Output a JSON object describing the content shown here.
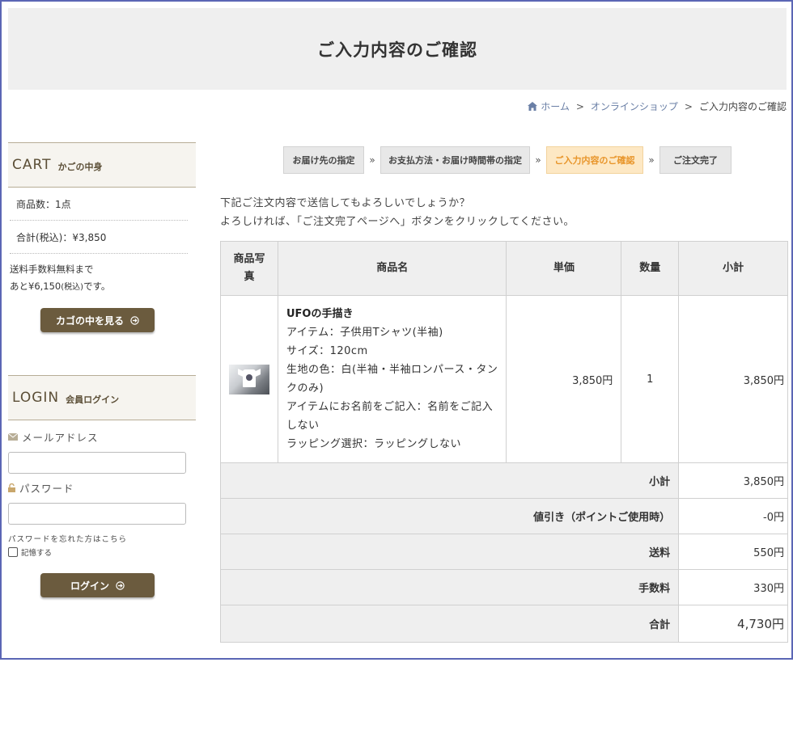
{
  "page": {
    "title": "ご入力内容のご確認"
  },
  "breadcrumb": {
    "home": "ホーム",
    "sep": ">",
    "shop": "オンラインショップ",
    "current": "ご入力内容のご確認"
  },
  "cart": {
    "title_en": "CART",
    "title_jp": "かごの中身",
    "count_line": "商品数：1点",
    "total_line": "合計(税込)：¥3,850",
    "ship_note_1": "送料手数料無料まで",
    "ship_note_2a": "あと¥6,150",
    "ship_note_2b": "(税込)",
    "ship_note_2c": "です。",
    "view_button": "カゴの中を見る"
  },
  "login": {
    "title_en": "LOGIN",
    "title_jp": "会員ログイン",
    "email_label": "メールアドレス",
    "password_label": "パスワード",
    "forgot": "パスワードを忘れた方はこちら",
    "remember": "記憶する",
    "login_button": "ログイン"
  },
  "steps": [
    {
      "label": "お届け先の指定"
    },
    {
      "label": "お支払方法・お届け時間帯の指定"
    },
    {
      "label": "ご入力内容のご確認"
    },
    {
      "label": "ご注文完了"
    }
  ],
  "step_sep": "»",
  "intro": {
    "line1": "下記ご注文内容で送信してもよろしいでしょうか？",
    "line2": "よろしければ、「ご注文完了ページへ」ボタンをクリックしてください。"
  },
  "table": {
    "headers": {
      "photo_1": "商品写",
      "photo_2": "真",
      "name": "商品名",
      "price": "単価",
      "qty": "数量",
      "subtotal": "小計"
    },
    "item": {
      "name": "UFOの手描き",
      "details": [
        "アイテム：子供用Tシャツ(半袖)",
        "サイズ：120cm",
        "生地の色：白(半袖・半袖ロンパース・タンクのみ)",
        "アイテムにお名前をご記入：名前をご記入しない",
        "ラッピング選択：ラッピングしない"
      ],
      "price": "3,850円",
      "qty": "1",
      "subtotal": "3,850円"
    },
    "summary": [
      {
        "label": "小計",
        "value": "3,850円"
      },
      {
        "label": "値引き（ポイントご使用時）",
        "value": "-0円"
      },
      {
        "label": "送料",
        "value": "550円"
      },
      {
        "label": "手数料",
        "value": "330円"
      },
      {
        "label": "合計",
        "value": "4,730円"
      }
    ]
  },
  "colors": {
    "accent_brown": "#6b5b3e",
    "active_step": "#e8952a",
    "frame": "#5b66b5",
    "link": "#6a7fa6"
  }
}
